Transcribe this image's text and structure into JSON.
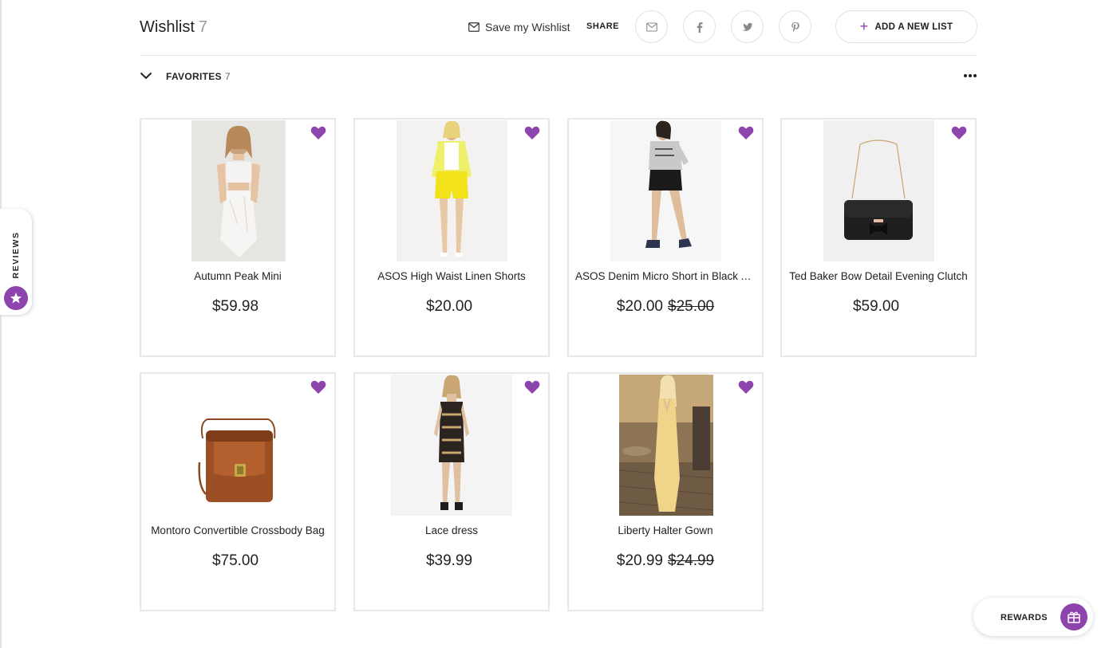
{
  "header": {
    "title": "Wishlist",
    "count": "7",
    "save_label": "Save my Wishlist",
    "share_label": "SHARE",
    "add_list_label": "ADD A NEW LIST"
  },
  "favorites": {
    "label": "FAVORITES",
    "count": "7"
  },
  "accent_color": "#8e44ad",
  "items": [
    {
      "name": "Autumn Peak Mini",
      "price": "$59.98",
      "old_price": ""
    },
    {
      "name": "ASOS High Waist Linen Shorts",
      "price": "$20.00",
      "old_price": ""
    },
    {
      "name": "ASOS Denim Micro Short in Black A...",
      "price": "$20.00",
      "old_price": "$25.00"
    },
    {
      "name": "Ted Baker Bow Detail Evening Clutch",
      "price": "$59.00",
      "old_price": ""
    },
    {
      "name": "Montoro Convertible Crossbody Bag",
      "price": "$75.00",
      "old_price": ""
    },
    {
      "name": "Lace dress",
      "price": "$39.99",
      "old_price": ""
    },
    {
      "name": "Liberty Halter Gown",
      "price": "$20.99",
      "old_price": "$24.99"
    }
  ],
  "reviews_tab": {
    "label": "REVIEWS"
  },
  "rewards": {
    "label": "REWARDS"
  }
}
